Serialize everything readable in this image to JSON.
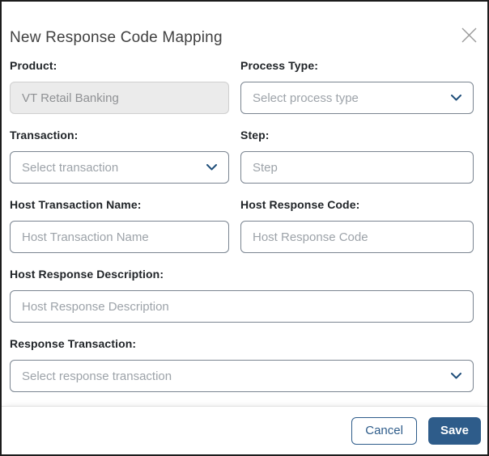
{
  "modal": {
    "title": "New Response Code Mapping"
  },
  "form": {
    "product": {
      "label": "Product:",
      "value": "VT Retail Banking",
      "disabled": true
    },
    "process_type": {
      "label": "Process Type:",
      "placeholder": "Select process type"
    },
    "transaction": {
      "label": "Transaction:",
      "placeholder": "Select transaction"
    },
    "step": {
      "label": "Step:",
      "placeholder": "Step"
    },
    "host_transaction_name": {
      "label": "Host Transaction Name:",
      "placeholder": "Host Transaction Name"
    },
    "host_response_code": {
      "label": "Host Response Code:",
      "placeholder": "Host Response Code"
    },
    "host_response_description": {
      "label": "Host Response Description:",
      "placeholder": "Host Response Description"
    },
    "response_transaction": {
      "label": "Response Transaction:",
      "placeholder": "Select response transaction"
    }
  },
  "footer": {
    "cancel_label": "Cancel",
    "save_label": "Save"
  },
  "icons": {
    "close": "x-icon",
    "dropdown": "chevron-down-icon"
  },
  "colors": {
    "accent": "#2e5c8a",
    "chevron": "#1f4e7a",
    "modal_border": "#1c1c1c",
    "field_border": "#7a8490",
    "disabled_bg": "#ebebeb",
    "placeholder": "#9da3a9",
    "label_text": "#212529"
  }
}
